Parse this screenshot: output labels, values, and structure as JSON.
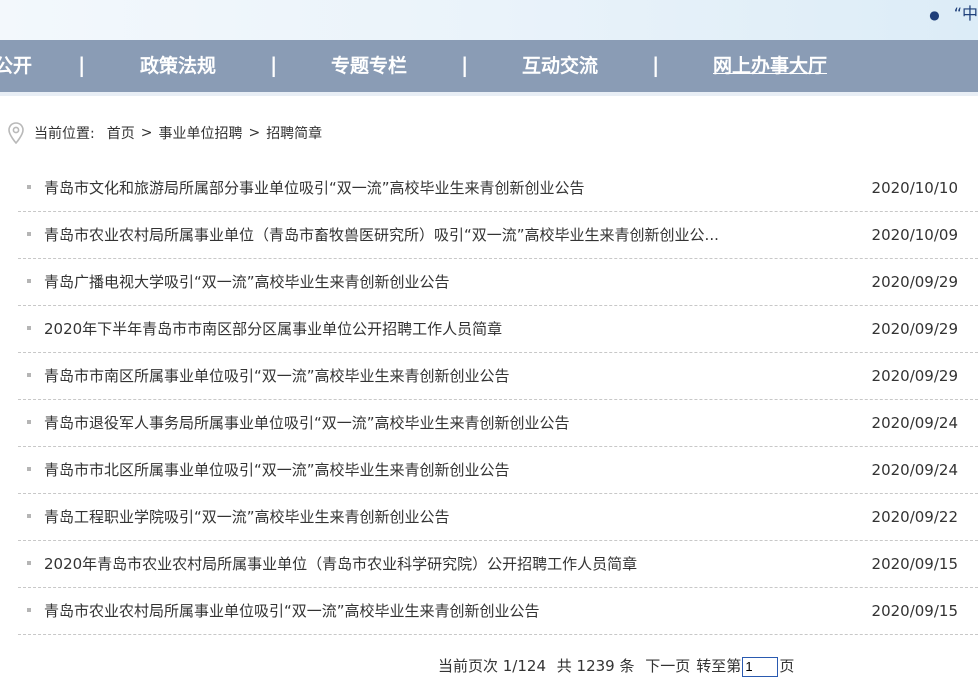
{
  "banner": {
    "text": "“中"
  },
  "nav": {
    "items": [
      {
        "label": "公开"
      },
      {
        "label": "政策法规"
      },
      {
        "label": "专题专栏"
      },
      {
        "label": "互动交流"
      },
      {
        "label": "网上办事大厅"
      }
    ],
    "separator": "|"
  },
  "breadcrumb": {
    "prefix": "当前位置:",
    "items": [
      "首页",
      "事业单位招聘",
      "招聘简章"
    ],
    "separator": ">"
  },
  "articles": [
    {
      "title": "青岛市文化和旅游局所属部分事业单位吸引“双一流”高校毕业生来青创新创业公告",
      "date": "2020/10/10"
    },
    {
      "title": "青岛市农业农村局所属事业单位（青岛市畜牧兽医研究所）吸引“双一流”高校毕业生来青创新创业公...",
      "date": "2020/10/09"
    },
    {
      "title": "青岛广播电视大学吸引“双一流”高校毕业生来青创新创业公告",
      "date": "2020/09/29"
    },
    {
      "title": "2020年下半年青岛市市南区部分区属事业单位公开招聘工作人员简章",
      "date": "2020/09/29"
    },
    {
      "title": "青岛市市南区所属事业单位吸引“双一流”高校毕业生来青创新创业公告",
      "date": "2020/09/29"
    },
    {
      "title": "青岛市退役军人事务局所属事业单位吸引“双一流”高校毕业生来青创新创业公告",
      "date": "2020/09/24"
    },
    {
      "title": "青岛市市北区所属事业单位吸引“双一流”高校毕业生来青创新创业公告",
      "date": "2020/09/24"
    },
    {
      "title": "青岛工程职业学院吸引“双一流”高校毕业生来青创新创业公告",
      "date": "2020/09/22"
    },
    {
      "title": "2020年青岛市农业农村局所属事业单位（青岛市农业科学研究院）公开招聘工作人员简章",
      "date": "2020/09/15"
    },
    {
      "title": "青岛市农业农村局所属事业单位吸引“双一流”高校毕业生来青创新创业公告",
      "date": "2020/09/15"
    }
  ],
  "pager": {
    "current_page": "当前页次 1/124",
    "total": "共 1239 条",
    "next_label": "下一页",
    "goto_prefix": "转至第",
    "goto_value": "1",
    "goto_suffix": "页"
  },
  "colors": {
    "nav_bg": "#8a9cb5",
    "banner_text": "#1f3f7a"
  }
}
